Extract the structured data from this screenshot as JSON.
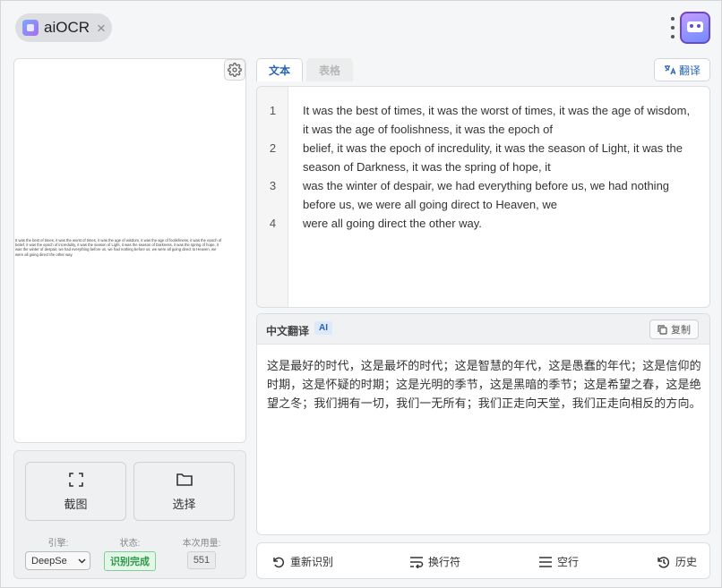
{
  "header": {
    "app_name": "aiOCR",
    "close_symbol": "×"
  },
  "image_preview": {
    "text_lines": [
      "It was the best of times, it was the worst of times, it was the age of wisdom, it was the age of foolishness, it was the epoch of",
      "belief, it was the epoch of incredulity, it was the season of Light, it was the season of Darkness, it was the spring of hope, it",
      "was the winter of despair, we had everything before us, we had nothing before us, we were all going direct to Heaven, we",
      "were all going direct the other way."
    ]
  },
  "controls": {
    "screenshot_label": "截图",
    "select_label": "选择",
    "engine_label": "引擎:",
    "engine_value": "DeepSe",
    "status_label": "状态:",
    "status_value": "识别完成",
    "usage_label": "本次用量:",
    "usage_value": "551"
  },
  "tabs": {
    "text": "文本",
    "table": "表格",
    "translate": "翻译"
  },
  "editor": {
    "lines": [
      {
        "num": "1",
        "text": "It was the best of times, it was the worst of times, it was the age of wisdom, it was the age of foolishness, it was the epoch of"
      },
      {
        "num": "2",
        "text": "belief, it was the epoch of incredulity, it was the season of Light, it was the season of Darkness, it was the spring of hope, it"
      },
      {
        "num": "3",
        "text": "was the winter of despair, we had everything before us, we had nothing before us, we were all going direct to Heaven, we"
      },
      {
        "num": "4",
        "text": "were all going direct the other way."
      }
    ]
  },
  "translation": {
    "title": "中文翻译",
    "badge": "AI",
    "copy_label": "复制",
    "text": "这是最好的时代，这是最坏的时代；这是智慧的年代，这是愚蠢的年代；这是信仰的时期，这是怀疑的时期；这是光明的季节，这是黑暗的季节；这是希望之春，这是绝望之冬；我们拥有一切，我们一无所有；我们正走向天堂，我们正走向相反的方向。"
  },
  "bottom_bar": {
    "reocr_label": "重新识别",
    "linebreak_label": "换行符",
    "blankline_label": "空行",
    "history_label": "历史"
  },
  "colors": {
    "accent": "#2563b7",
    "status_green": "#2e9a49"
  }
}
